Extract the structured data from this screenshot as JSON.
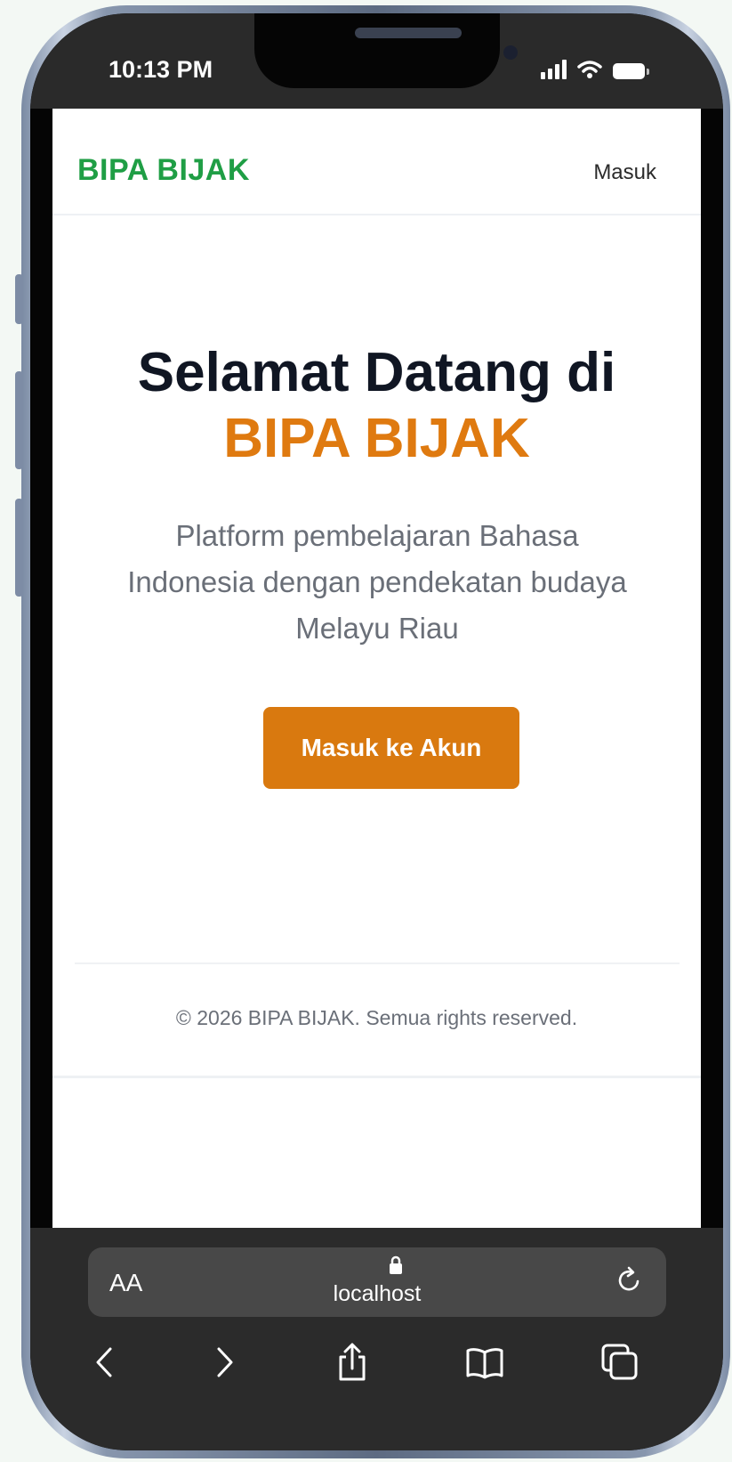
{
  "status_bar": {
    "time": "10:13 PM",
    "icons": [
      "signal-icon",
      "wifi-icon",
      "battery-icon"
    ]
  },
  "header": {
    "brand": "BIPA BIJAK",
    "login_link": "Masuk"
  },
  "hero": {
    "title_line1": "Selamat Datang di",
    "title_brand": "BIPA BIJAK",
    "description": "Platform pembelajaran Bahasa Indonesia dengan pendekatan budaya Melayu Riau",
    "cta_label": "Masuk ke Akun"
  },
  "footer": {
    "copyright": "© 2026 BIPA BIJAK. Semua rights reserved."
  },
  "browser": {
    "text_size_label": "AA",
    "url": "localhost",
    "toolbar_icons": [
      "back-icon",
      "forward-icon",
      "share-icon",
      "bookmarks-icon",
      "tabs-icon",
      "reload-icon",
      "lock-icon"
    ]
  },
  "colors": {
    "brand_green": "#1f9e45",
    "accent_orange": "#df7a10",
    "button_orange": "#d9790f",
    "title_dark": "#101623",
    "body_gray": "#6a6f78"
  }
}
